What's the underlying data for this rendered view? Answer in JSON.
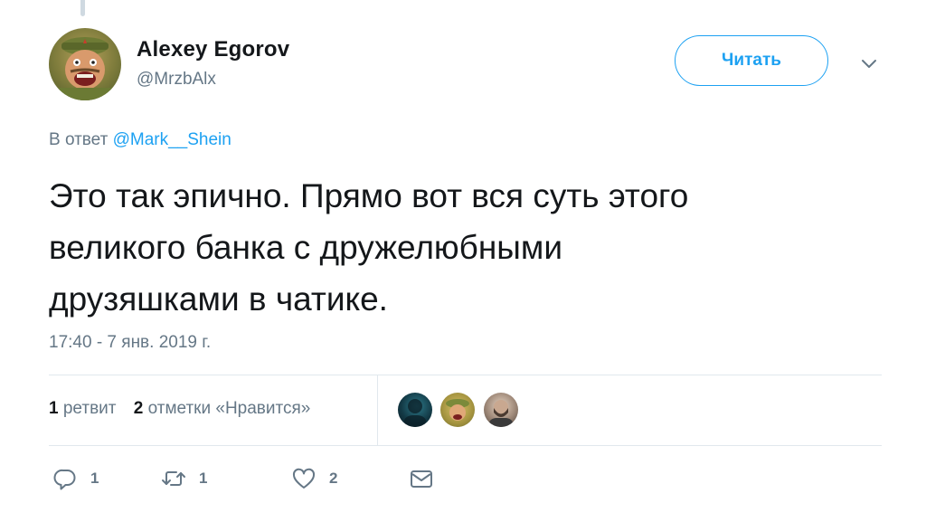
{
  "tweet": {
    "author": {
      "name": "Alexey Egorov",
      "handle": "@MrzbAlx"
    },
    "follow_label": "Читать",
    "reply_to": {
      "prefix": "В ответ",
      "mention": "@Mark__Shein"
    },
    "text": "Это так эпично. Прямо вот вся суть этого\nвеликого банка с дружелюбными\nдрузяшками в чатике.",
    "timestamp": "17:40 - 7 янв. 2019 г."
  },
  "stats": {
    "retweets_count": "1",
    "retweets_label": "ретвит",
    "likes_count": "2",
    "likes_label": "отметки «Нравится»"
  },
  "actions": {
    "reply_count": "1",
    "retweet_count": "1",
    "like_count": "2"
  },
  "icons": {
    "reply": "reply-icon",
    "retweet": "retweet-icon",
    "like": "heart-icon",
    "dm": "envelope-icon",
    "menu": "chevron-down-icon"
  },
  "colors": {
    "accent": "#1da1f2",
    "secondary_text": "#657786",
    "primary_text": "#14171a",
    "divider": "#e1e8ed"
  }
}
